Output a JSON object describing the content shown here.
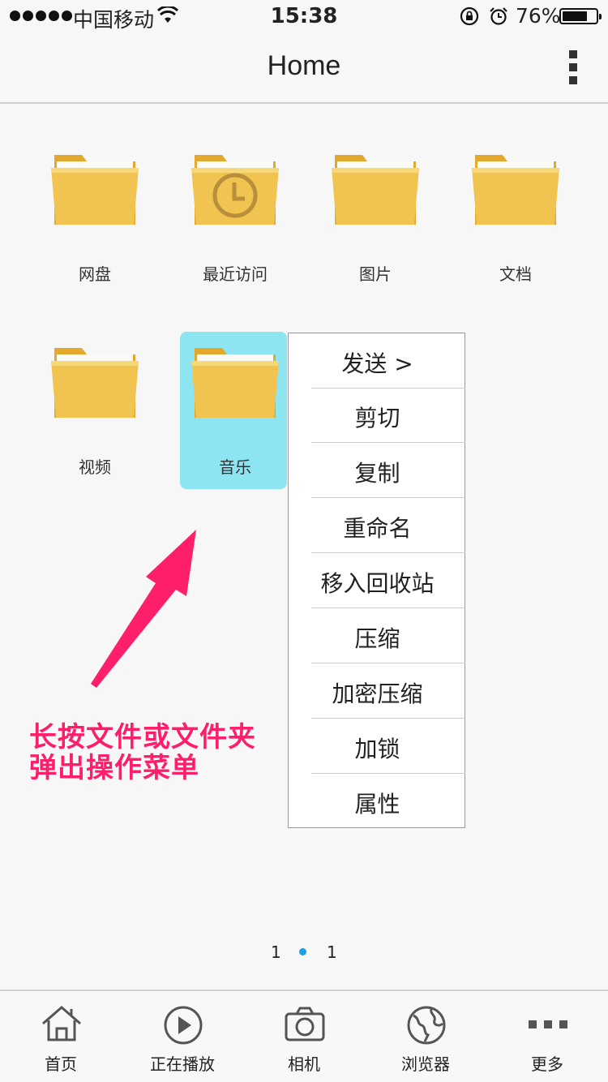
{
  "status_bar": {
    "carrier": "中国移动",
    "time": "15:38",
    "battery_percent": "76%",
    "battery_level": 0.76
  },
  "nav": {
    "title": "Home"
  },
  "folders": [
    {
      "label": "网盘",
      "icon": "folder-icon"
    },
    {
      "label": "最近访问",
      "icon": "folder-clock-icon"
    },
    {
      "label": "图片",
      "icon": "folder-icon"
    },
    {
      "label": "文档",
      "icon": "folder-icon"
    },
    {
      "label": "视频",
      "icon": "folder-icon"
    },
    {
      "label": "音乐",
      "icon": "folder-icon",
      "selected": true
    }
  ],
  "context_menu": {
    "items": [
      "发送 >",
      "剪切",
      "复制",
      "重命名",
      "移入回收站",
      "压缩",
      "加密压缩",
      "加锁",
      "属性"
    ]
  },
  "annotation": {
    "line1": "长按文件或文件夹",
    "line2": "弹出操作菜单",
    "color": "#ff1e6a"
  },
  "pager": {
    "left": "1",
    "right": "1",
    "dot_color": "#1a9ee6"
  },
  "tab_bar": {
    "items": [
      {
        "label": "首页",
        "icon": "home-icon"
      },
      {
        "label": "正在播放",
        "icon": "play-icon"
      },
      {
        "label": "相机",
        "icon": "camera-icon"
      },
      {
        "label": "浏览器",
        "icon": "globe-icon"
      },
      {
        "label": "更多",
        "icon": "more-dots-icon"
      }
    ]
  },
  "colors": {
    "folder": "#f0c24c",
    "selection": "#8ee5f2"
  }
}
